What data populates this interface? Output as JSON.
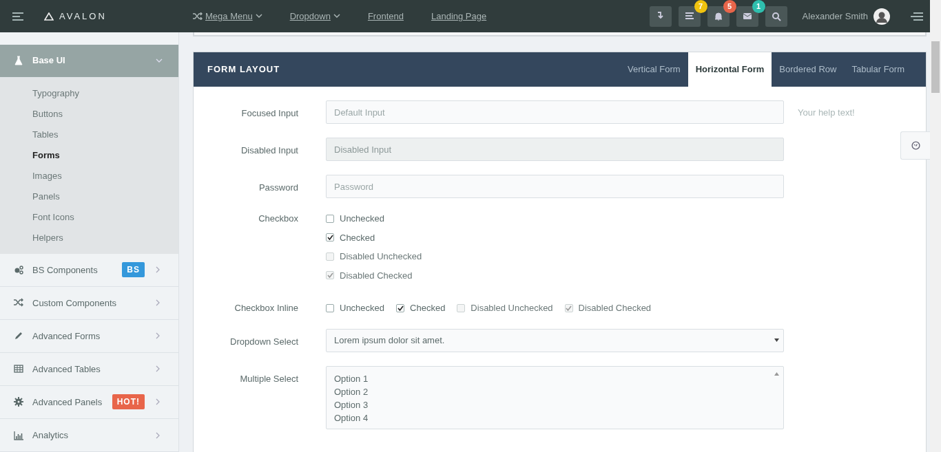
{
  "topbar": {
    "brand": "AVALON",
    "nav": [
      {
        "label": "Mega Menu",
        "icon": true,
        "caret": true
      },
      {
        "label": "Dropdown",
        "icon": false,
        "caret": true
      },
      {
        "label": "Frontend",
        "icon": false,
        "caret": false
      },
      {
        "label": "Landing Page",
        "icon": false,
        "caret": false
      }
    ],
    "actions": [
      {
        "kind": "download"
      },
      {
        "kind": "tasks",
        "badge": "7",
        "color": "#f0c30f"
      },
      {
        "kind": "bell",
        "badge": "5",
        "color": "#e8654a"
      },
      {
        "kind": "mail",
        "badge": "1",
        "color": "#2fbfae"
      },
      {
        "kind": "search"
      }
    ],
    "user": "Alexander Smith"
  },
  "sidebar": {
    "items": [
      {
        "label": "Base UI",
        "kind": "flask",
        "expanded": true,
        "children": [
          {
            "label": "Typography",
            "selected": false
          },
          {
            "label": "Buttons",
            "selected": false
          },
          {
            "label": "Tables",
            "selected": false
          },
          {
            "label": "Forms",
            "selected": true
          },
          {
            "label": "Images",
            "selected": false
          },
          {
            "label": "Panels",
            "selected": false
          },
          {
            "label": "Font Icons",
            "selected": false
          },
          {
            "label": "Helpers",
            "selected": false
          }
        ]
      },
      {
        "label": "BS Components",
        "kind": "cogs",
        "expanded": false,
        "badge": "BS",
        "color": "#3498db"
      },
      {
        "label": "Custom Components",
        "kind": "shuffle",
        "expanded": false
      },
      {
        "label": "Advanced Forms",
        "kind": "pencil",
        "expanded": false
      },
      {
        "label": "Advanced Tables",
        "kind": "table",
        "expanded": false
      },
      {
        "label": "Advanced Panels",
        "kind": "gear",
        "expanded": false,
        "badge": "HOT!",
        "color": "#e8654a"
      },
      {
        "label": "Analytics",
        "kind": "chart",
        "expanded": false
      }
    ]
  },
  "panel": {
    "title": "FORM LAYOUT",
    "tabs": [
      {
        "label": "Vertical Form",
        "selected": false
      },
      {
        "label": "Horizontal Form",
        "selected": true
      },
      {
        "label": "Bordered Row",
        "selected": false
      },
      {
        "label": "Tabular Form",
        "selected": false
      }
    ],
    "rows": [
      {
        "kind": "input",
        "label": "Focused Input",
        "placeholder": "Default Input",
        "disabled": false,
        "help": "Your help text!"
      },
      {
        "kind": "input",
        "label": "Disabled Input",
        "placeholder": "Disabled Input",
        "disabled": true
      },
      {
        "kind": "input",
        "label": "Password",
        "placeholder": "Password",
        "disabled": false
      },
      {
        "kind": "checkbox",
        "label": "Checkbox",
        "options": [
          {
            "label": "Unchecked",
            "checked": false,
            "disabled": false
          },
          {
            "label": "Checked",
            "checked": true,
            "disabled": false
          },
          {
            "label": "Disabled Unchecked",
            "checked": false,
            "disabled": true
          },
          {
            "label": "Disabled Checked",
            "checked": true,
            "disabled": true
          }
        ]
      },
      {
        "kind": "checkbox_inline",
        "label": "Checkbox Inline",
        "options": [
          {
            "label": "Unchecked",
            "checked": false,
            "disabled": false
          },
          {
            "label": "Checked",
            "checked": true,
            "disabled": false
          },
          {
            "label": "Disabled Unchecked",
            "checked": false,
            "disabled": true
          },
          {
            "label": "Disabled Checked",
            "checked": true,
            "disabled": true
          }
        ]
      },
      {
        "kind": "select",
        "label": "Dropdown Select",
        "value": "Lorem ipsum dolor sit amet."
      },
      {
        "kind": "multiselect",
        "label": "Multiple Select",
        "options": [
          "Option 1",
          "Option 2",
          "Option 3",
          "Option 4"
        ]
      }
    ]
  }
}
